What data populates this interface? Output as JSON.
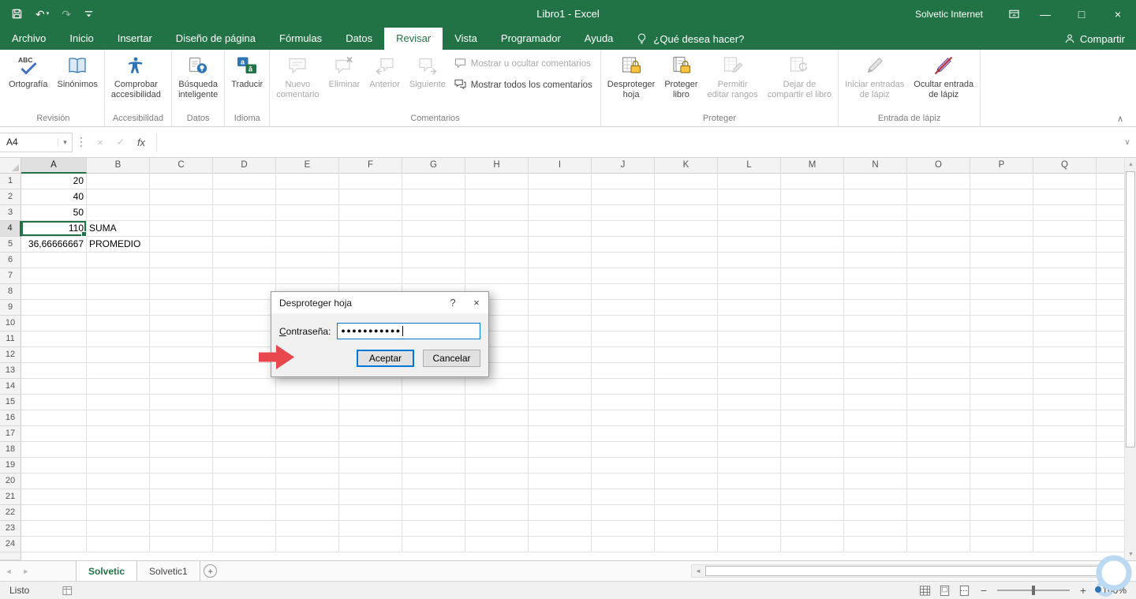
{
  "icons": {
    "undo": "↶",
    "redo": "↷",
    "dropdown": "▾",
    "minimize": "—",
    "maximize": "□",
    "close": "×",
    "up_arrow": "▲",
    "down_arrow": "▼",
    "left_arrow": "◄",
    "right_arrow": "►",
    "collapse_ribbon": "∧",
    "expand_formula": "∨",
    "cancel": "×",
    "check": "✓",
    "fx": "fx",
    "help": "?",
    "plus": "+",
    "minus": "−",
    "add_sheet": "+"
  },
  "title_bar": {
    "title": "Libro1 - Excel",
    "user_name": "Solvetic Internet"
  },
  "ribbon": {
    "tabs": [
      {
        "label": "Archivo",
        "file": true
      },
      {
        "label": "Inicio"
      },
      {
        "label": "Insertar"
      },
      {
        "label": "Diseño de página"
      },
      {
        "label": "Fórmulas"
      },
      {
        "label": "Datos"
      },
      {
        "label": "Revisar",
        "active": true
      },
      {
        "label": "Vista"
      },
      {
        "label": "Programador"
      },
      {
        "label": "Ayuda"
      }
    ],
    "tell_me": "¿Qué desea hacer?",
    "share_label": "Compartir",
    "groups": [
      {
        "name": "Revisión",
        "buttons": [
          {
            "label": "Ortografía",
            "icon": "spellcheck"
          },
          {
            "label": "Sinónimos",
            "icon": "thesaurus"
          }
        ]
      },
      {
        "name": "Accesibilidad",
        "buttons": [
          {
            "label": "Comprobar\naccesibilidad",
            "icon": "accessibility"
          }
        ]
      },
      {
        "name": "Datos",
        "buttons": [
          {
            "label": "Búsqueda\ninteligente",
            "icon": "smart-lookup"
          }
        ]
      },
      {
        "name": "Idioma",
        "buttons": [
          {
            "label": "Traducir",
            "icon": "translate"
          }
        ]
      },
      {
        "name": "Comentarios",
        "buttons": [
          {
            "label": "Nuevo\ncomentario",
            "icon": "new-comment",
            "disabled": true
          },
          {
            "label": "Eliminar",
            "icon": "delete-comment",
            "disabled": true
          },
          {
            "label": "Anterior",
            "icon": "previous-comment",
            "disabled": true
          },
          {
            "label": "Siguiente",
            "icon": "next-comment",
            "disabled": true
          }
        ],
        "stack": [
          {
            "label": "Mostrar u ocultar comentarios",
            "icon": "show-hide-comments",
            "disabled": true
          },
          {
            "label": "Mostrar todos los comentarios",
            "icon": "show-all-comments",
            "disabled": false
          }
        ]
      },
      {
        "name": "Proteger",
        "buttons": [
          {
            "label": "Desproteger\nhoja",
            "icon": "unprotect-sheet"
          },
          {
            "label": "Proteger\nlibro",
            "icon": "protect-workbook"
          },
          {
            "label": "Permitir\neditar rangos",
            "icon": "allow-edit-ranges",
            "disabled": true
          },
          {
            "label": "Dejar de\ncompartir el libro",
            "icon": "unshare-workbook",
            "disabled": true
          }
        ]
      },
      {
        "name": "Entrada de lápiz",
        "buttons": [
          {
            "label": "Iniciar entradas\nde lápiz",
            "icon": "start-inking",
            "disabled": true
          },
          {
            "label": "Ocultar entrada\nde lápiz",
            "icon": "hide-ink"
          }
        ]
      }
    ]
  },
  "formula_bar": {
    "name_box": "A4",
    "formula": ""
  },
  "grid": {
    "columns": [
      "A",
      "B",
      "C",
      "D",
      "E",
      "F",
      "G",
      "H",
      "I",
      "J",
      "K",
      "L",
      "M",
      "N",
      "O",
      "P",
      "Q"
    ],
    "row_count": 24,
    "selected_column": "A",
    "selected_row": 4,
    "selected_ref": "A4",
    "cells": [
      {
        "col": "A",
        "row": 1,
        "value": "20",
        "align": "right"
      },
      {
        "col": "A",
        "row": 2,
        "value": "40",
        "align": "right"
      },
      {
        "col": "A",
        "row": 3,
        "value": "50",
        "align": "right"
      },
      {
        "col": "A",
        "row": 4,
        "value": "110",
        "align": "right",
        "selected": true
      },
      {
        "col": "B",
        "row": 4,
        "value": "SUMA",
        "align": "left"
      },
      {
        "col": "A",
        "row": 5,
        "value": "36,66666667",
        "align": "right"
      },
      {
        "col": "B",
        "row": 5,
        "value": "PROMEDIO",
        "align": "left"
      }
    ]
  },
  "dialog": {
    "title": "Desproteger hoja",
    "password_label": "Contraseña:",
    "password_value": "●●●●●●●●●●●",
    "ok_label": "Aceptar",
    "cancel_label": "Cancelar"
  },
  "sheet_tabs": {
    "tabs": [
      {
        "label": "Solvetic",
        "active": true
      },
      {
        "label": "Solvetic1",
        "active": false
      }
    ]
  },
  "status_bar": {
    "mode": "Listo",
    "zoom": "100%"
  }
}
